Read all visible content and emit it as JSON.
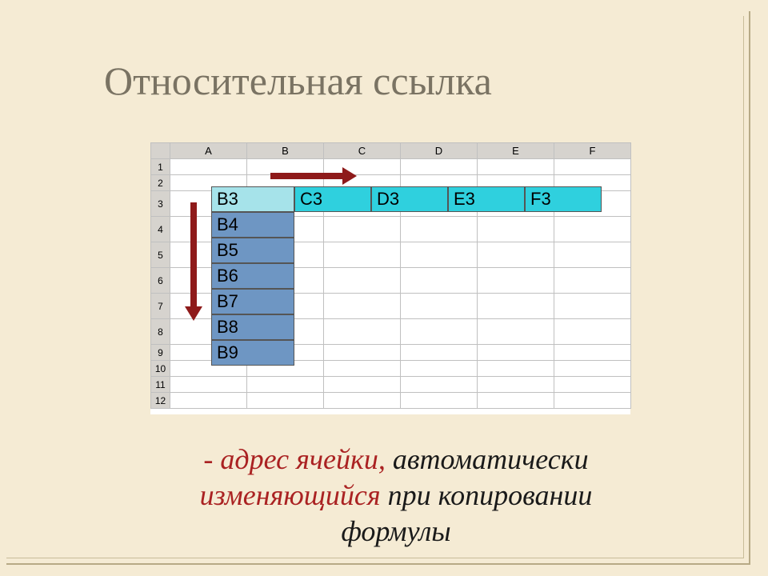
{
  "title": "Относительная ссылка",
  "columns": [
    "A",
    "B",
    "C",
    "D",
    "E",
    "F"
  ],
  "rows": [
    "1",
    "2",
    "3",
    "4",
    "5",
    "6",
    "7",
    "8",
    "9",
    "10",
    "11",
    "12"
  ],
  "row3": {
    "b": "B3",
    "c": "C3",
    "d": "D3",
    "e": "E3",
    "f": "F3"
  },
  "colB": {
    "r4": "B4",
    "r5": "B5",
    "r6": "B6",
    "r7": "B7",
    "r8": "B8",
    "r9": "B9"
  },
  "caption": {
    "dash": "- ",
    "part1": "адрес  ячейки,",
    "part2": "   автоматически",
    "part3": "изменяющийся",
    "part4": "  при  копировании",
    "part5": "формулы"
  }
}
